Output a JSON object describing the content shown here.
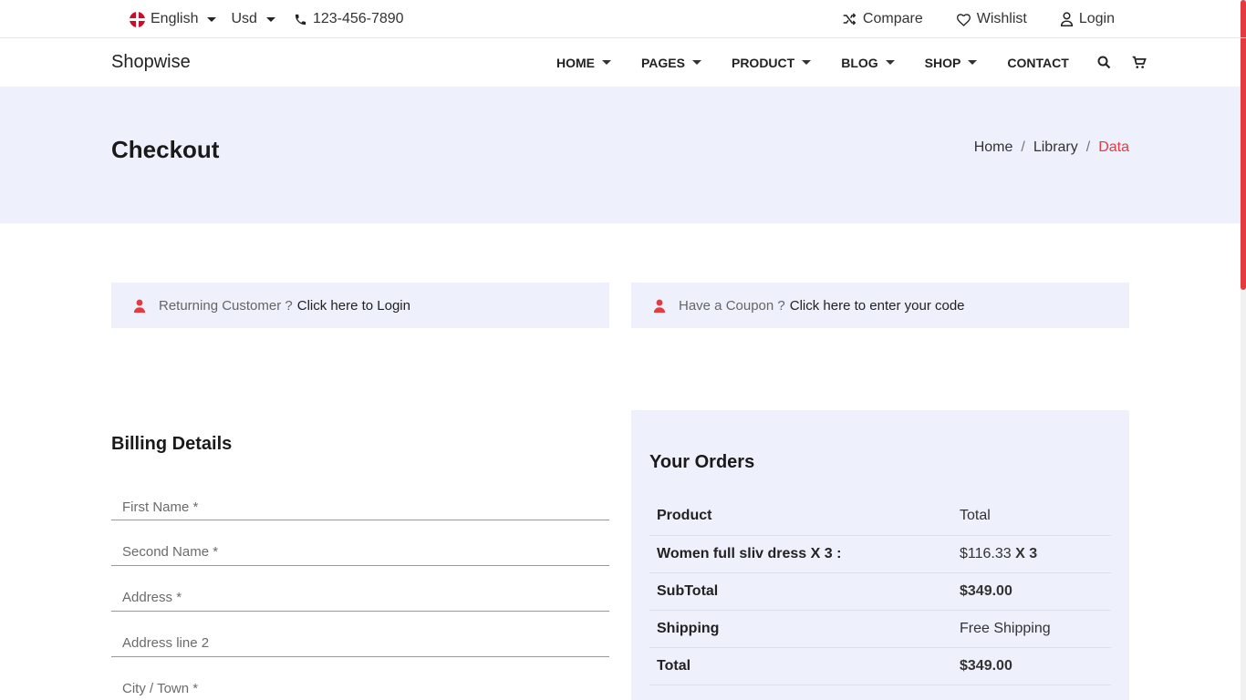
{
  "topbar": {
    "language": "English",
    "currency": "Usd",
    "phone": "123-456-7890",
    "compare": "Compare",
    "wishlist": "Wishlist",
    "login": "Login"
  },
  "brand": "Shopwise",
  "nav": {
    "home": "HOME",
    "pages": "PAGES",
    "product": "PRODUCT",
    "blog": "BLOG",
    "shop": "SHOP",
    "contact": "CONTACT"
  },
  "page": {
    "title": "Checkout",
    "breadcrumb": [
      "Home",
      "Library",
      "Data"
    ]
  },
  "notices": {
    "returning_prefix": "Returning Customer ?",
    "returning_link": "Click here to Login",
    "coupon_prefix": "Have a Coupon ?",
    "coupon_link": "Click here to enter your code"
  },
  "billing": {
    "title": "Billing Details",
    "fields": [
      "First Name *",
      "Second Name *",
      "Address *",
      "Address line 2",
      "City / Town *"
    ]
  },
  "orders": {
    "title": "Your Orders",
    "header": {
      "product": "Product",
      "total": "Total"
    },
    "item": {
      "name": "Women full sliv dress",
      "qty_label": "X 3 :",
      "price": "$116.33",
      "qty": "X 3"
    },
    "subtotal": {
      "label": "SubTotal",
      "value": "$349.00"
    },
    "shipping": {
      "label": "Shipping",
      "value": "Free Shipping"
    },
    "total": {
      "label": "Total",
      "value": "$349.00"
    }
  },
  "colors": {
    "accent": "#e53a3f",
    "band": "#eef0fc"
  },
  "icons": [
    "flag-icon",
    "phone-icon",
    "shuffle-icon",
    "heart-icon",
    "user-icon",
    "search-icon",
    "cart-icon"
  ]
}
